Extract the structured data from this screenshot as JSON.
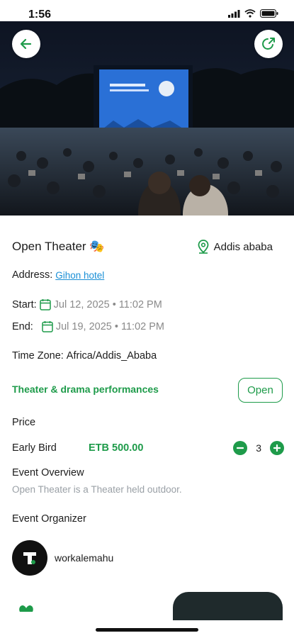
{
  "status_bar": {
    "time": "1:56"
  },
  "event": {
    "title": "Open Theater 🎭",
    "location": "Addis ababa",
    "address_label": "Address:",
    "address_value": "Gihon hotel",
    "start_label": "Start:",
    "start_value": "Jul 12, 2025 • 11:02 PM",
    "end_label": "End:",
    "end_value": "Jul 19, 2025 • 11:02 PM",
    "timezone_label": "Time Zone:",
    "timezone_value": "Africa/Addis_Ababa",
    "category": "Theater & drama performances",
    "status_button": "Open"
  },
  "price": {
    "heading": "Price",
    "tickets": [
      {
        "name": "Early Bird",
        "price": "ETB 500.00",
        "quantity": "3"
      }
    ]
  },
  "overview": {
    "heading": "Event Overview",
    "text": "Open Theater is a Theater held outdoor."
  },
  "organizer": {
    "heading": "Event Organizer",
    "name": "workalemahu"
  },
  "colors": {
    "accent": "#1e9b4a",
    "link": "#1a8fd6",
    "muted": "#8a8a8a",
    "dark_button": "#1f2a2c"
  },
  "icons": {
    "back": "arrow-left-icon",
    "share": "share-icon",
    "location": "map-pin-icon",
    "calendar": "calendar-icon",
    "minus": "minus-icon",
    "plus": "plus-icon",
    "favorite": "heart-icon"
  }
}
